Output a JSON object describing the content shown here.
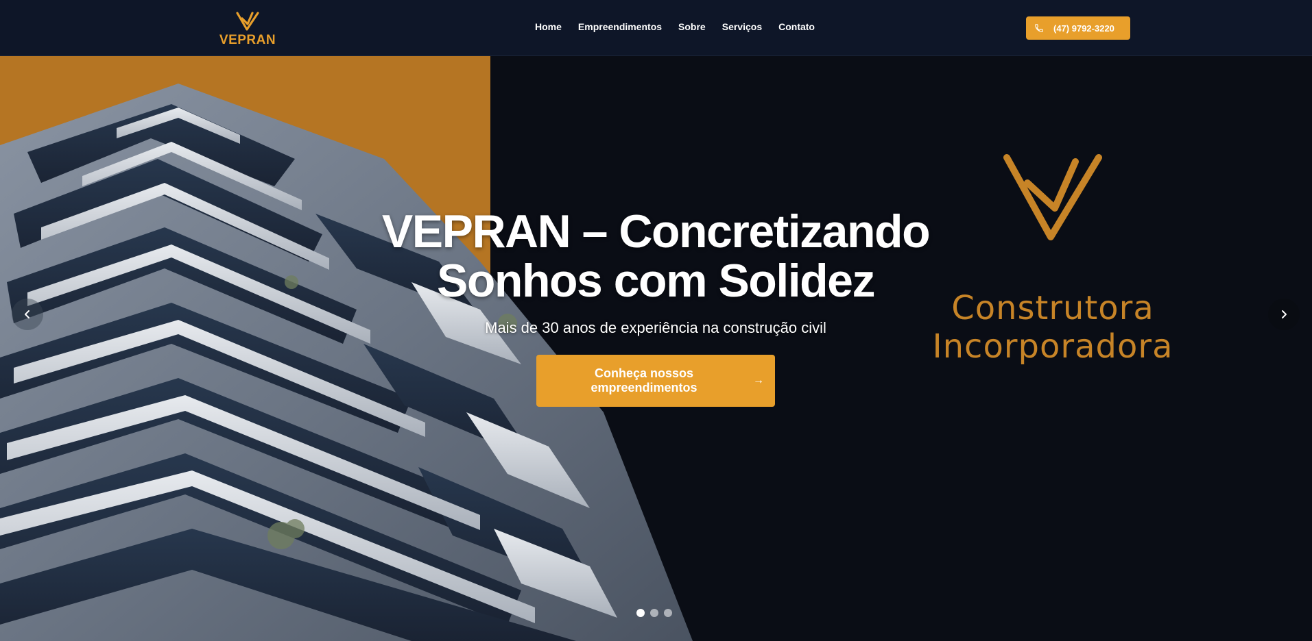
{
  "header": {
    "logo_text": "VEPRAN",
    "nav": [
      {
        "label": "Home"
      },
      {
        "label": "Empreendimentos"
      },
      {
        "label": "Sobre"
      },
      {
        "label": "Serviços"
      },
      {
        "label": "Contato"
      }
    ],
    "phone": "(47) 9792-3220",
    "phone_icon": "phone-icon"
  },
  "hero": {
    "title_line1": "VEPRAN – Concretizando",
    "title_line2": "Sonhos com Solidez",
    "subtitle": "Mais de 30 anos de experiência na construção civil",
    "cta_label": "Conheça nossos empreendimentos",
    "cta_icon": "arrow-right-icon",
    "tagline_line1": "Construtora",
    "tagline_line2": "Incorporadora",
    "prev_icon": "chevron-left-icon",
    "next_icon": "chevron-right-icon",
    "slides": 3,
    "active_slide": 1
  },
  "colors": {
    "accent": "#e89f2b",
    "header_bg": "#0e1628",
    "hero_bg": "#0a0d15",
    "orange_panel": "#b57523"
  }
}
